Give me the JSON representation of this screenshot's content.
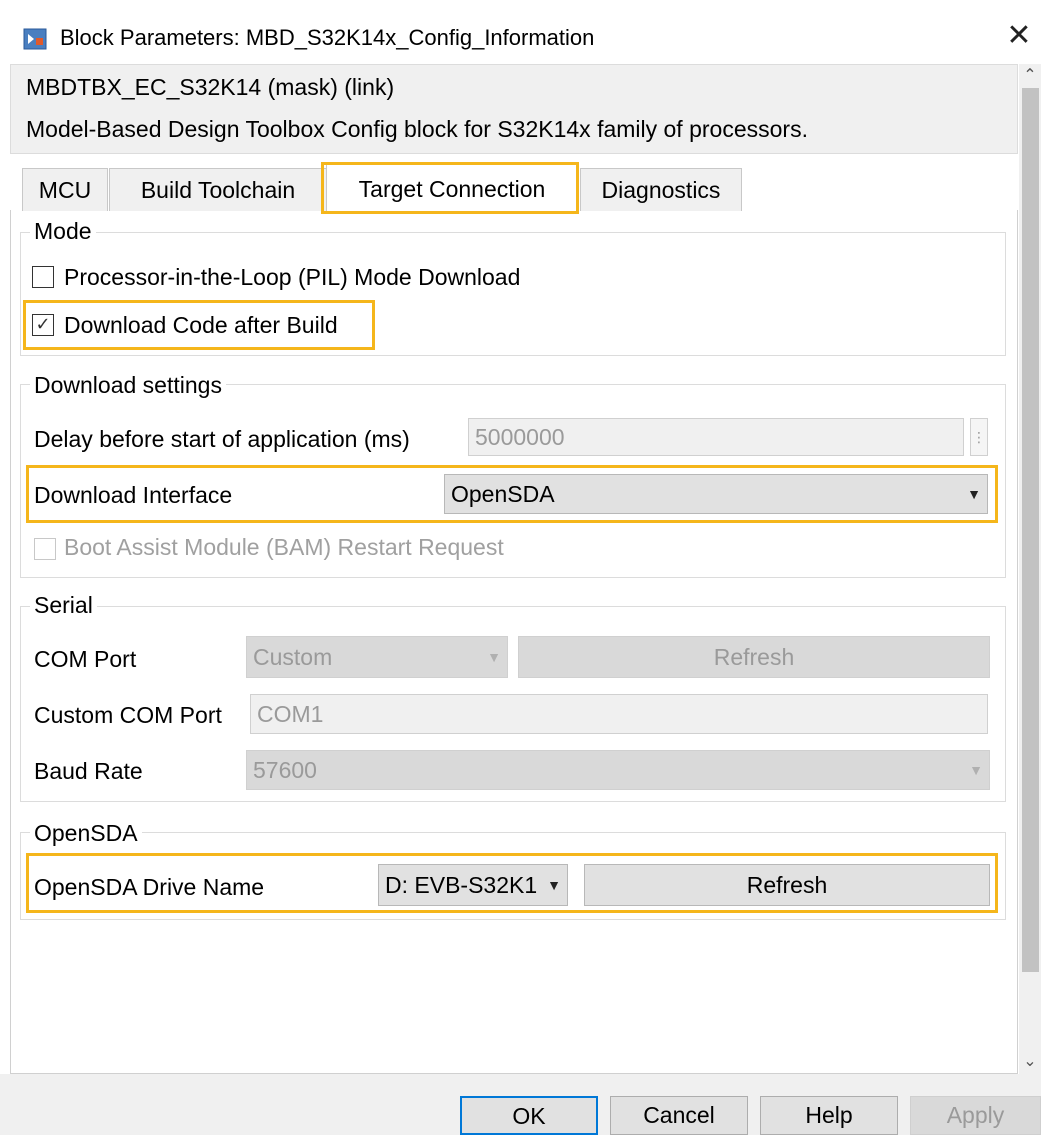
{
  "window": {
    "title": "Block Parameters: MBD_S32K14x_Config_Information",
    "close_glyph": "✕"
  },
  "header": {
    "mask_title": "MBDTBX_EC_S32K14 (mask) (link)",
    "description": "Model-Based Design Toolbox Config block for S32K14x family of processors."
  },
  "tabs": [
    {
      "label": "MCU"
    },
    {
      "label": "Build Toolchain"
    },
    {
      "label": "Target Connection",
      "active": true
    },
    {
      "label": "Diagnostics"
    }
  ],
  "mode": {
    "group_label": "Mode",
    "pil_label": "Processor-in-the-Loop (PIL) Mode Download",
    "pil_checked": false,
    "download_label": "Download Code after Build",
    "download_checked": true
  },
  "download_settings": {
    "group_label": "Download settings",
    "delay_label": "Delay before start of application (ms)",
    "delay_value": "5000000",
    "interface_label": "Download Interface",
    "interface_value": "OpenSDA",
    "bam_label": "Boot Assist Module (BAM) Restart Request",
    "bam_checked": false
  },
  "serial": {
    "group_label": "Serial",
    "com_port_label": "COM Port",
    "com_port_value": "Custom",
    "refresh_label": "Refresh",
    "custom_com_label": "Custom COM Port",
    "custom_com_value": "COM1",
    "baud_label": "Baud Rate",
    "baud_value": "57600"
  },
  "opensda": {
    "group_label": "OpenSDA",
    "drive_label": "OpenSDA Drive Name",
    "drive_value": "D: EVB-S32K1",
    "refresh_label": "Refresh"
  },
  "footer": {
    "ok": "OK",
    "cancel": "Cancel",
    "help": "Help",
    "apply": "Apply"
  },
  "colors": {
    "highlight": "#f5b61b"
  }
}
